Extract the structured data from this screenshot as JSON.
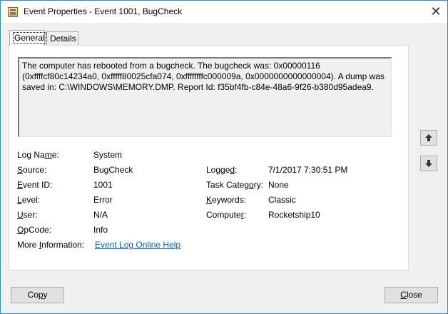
{
  "window": {
    "title": "Event Properties - Event 1001, BugCheck",
    "close_glyph": "✕"
  },
  "tabs": [
    {
      "label": "General"
    },
    {
      "label": "Details"
    }
  ],
  "event": {
    "description": "The computer has rebooted from a bugcheck.  The bugcheck was: 0x00000116 (0xffffcf80c14234a0, 0xfffff80025cfa074, 0xffffffffc000009a, 0x0000000000000004). A dump was saved in: C:\\WINDOWS\\MEMORY.DMP. Report Id: f35bf4fb-c84e-48a6-9f26-b380d95adea9.",
    "fields": {
      "log_name": {
        "label_pre": "Log Na",
        "label_ul": "m",
        "label_post": "e:",
        "value": "System"
      },
      "source": {
        "label_pre": "",
        "label_ul": "S",
        "label_post": "ource:",
        "value": "BugCheck"
      },
      "event_id": {
        "label_pre": "",
        "label_ul": "E",
        "label_post": "vent ID:",
        "value": "1001"
      },
      "level": {
        "label_pre": "",
        "label_ul": "L",
        "label_post": "evel:",
        "value": "Error"
      },
      "user": {
        "label_pre": "",
        "label_ul": "U",
        "label_post": "ser:",
        "value": "N/A"
      },
      "opcode": {
        "label_pre": "",
        "label_ul": "O",
        "label_post": "pCode:",
        "value": "Info"
      },
      "more_info": {
        "label_pre": "More ",
        "label_ul": "I",
        "label_post": "nformation:",
        "value": "Event Log Online Help"
      },
      "logged": {
        "label_pre": "Logge",
        "label_ul": "d",
        "label_post": ":",
        "value": "7/1/2017 7:30:51 PM"
      },
      "task_category": {
        "label_pre": "Task Categ",
        "label_ul": "o",
        "label_post": "ry:",
        "value": "None"
      },
      "keywords": {
        "label_pre": "",
        "label_ul": "K",
        "label_post": "eywords:",
        "value": "Classic"
      },
      "computer": {
        "label_pre": "Compute",
        "label_ul": "r",
        "label_post": ":",
        "value": "Rocketship10"
      }
    }
  },
  "buttons": {
    "copy": {
      "label_pre": "Co",
      "label_ul": "p",
      "label_post": "y"
    },
    "close": {
      "label_pre": "",
      "label_ul": "C",
      "label_post": "lose"
    }
  },
  "icons": {
    "prev": "arrow-up-icon",
    "next": "arrow-down-icon"
  }
}
